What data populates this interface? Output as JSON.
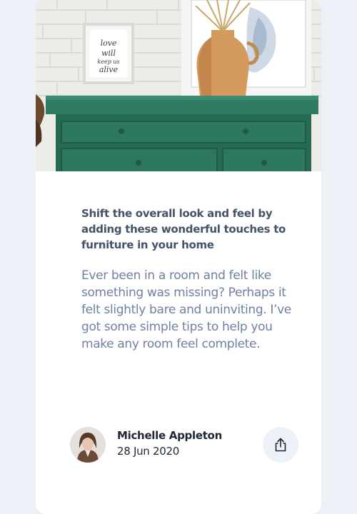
{
  "card": {
    "headline": "Shift the overall look and feel by adding these wonderful touches to furniture in your home",
    "excerpt": "Ever been in a room and felt like something was missing? Perhaps it felt slightly bare and uninviting. I’ve got some simple tips to help you make any room feel complete.",
    "hero_frame_text": "love will keep us alive"
  },
  "author": {
    "name": "Michelle Appleton",
    "date": "28 Jun 2020"
  },
  "icons": {
    "share": "share-icon"
  },
  "colors": {
    "background": "#EDF1F7",
    "card": "#FFFFFF",
    "headline": "#44526A",
    "excerpt": "#6E80A4",
    "author_text": "#1F2733",
    "share_button": "#ECF2F8",
    "dresser": "#2E7A62"
  }
}
